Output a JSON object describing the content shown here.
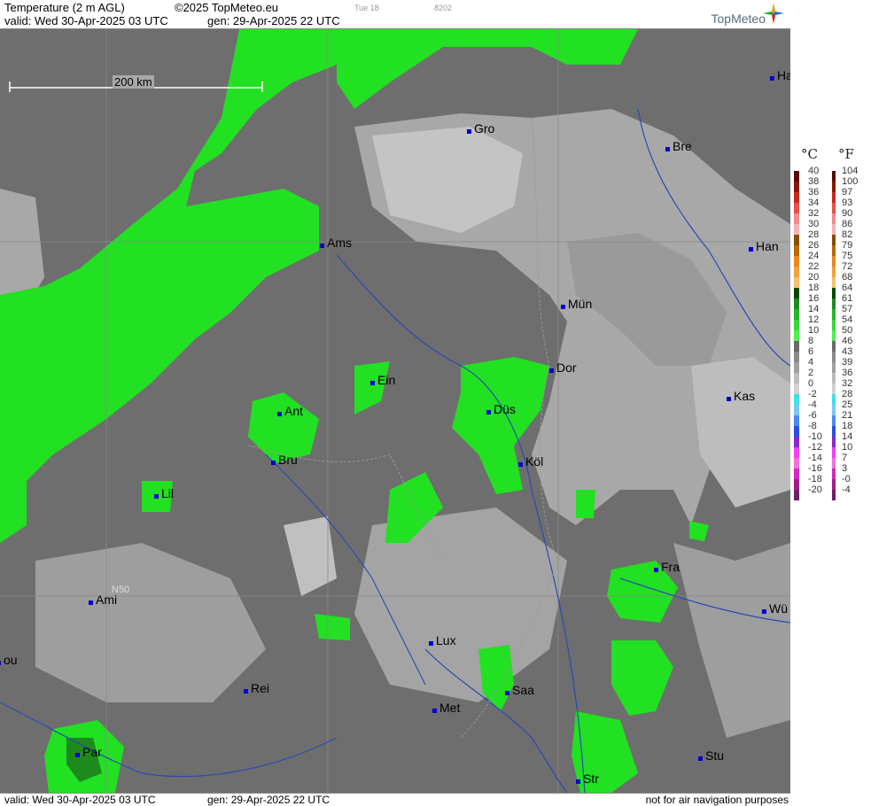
{
  "header": {
    "title": "Temperature (2 m AGL)",
    "copyright": "©2025 TopMeteo.eu",
    "run_small_1": "Tue 18",
    "run_small_2": "8202",
    "valid": "valid:  Wed  30-Apr-2025  03 UTC",
    "gen": "gen:  29-Apr-2025 22 UTC",
    "logo_text": "TopMeteo"
  },
  "footer": {
    "valid": "valid:  Wed  30-Apr-2025  03 UTC",
    "gen": "gen:  29-Apr-2025 22 UTC",
    "disclaimer": "not for air navigation purposes"
  },
  "map": {
    "scale_label": "200 km",
    "lat_label": "N50",
    "cities": [
      "Gro",
      "Bre",
      "Ha",
      "Ams",
      "Han",
      "Mün",
      "Dor",
      "Ein",
      "Kas",
      "Ant",
      "Düs",
      "Bru",
      "Köl",
      "Lil",
      "Fra",
      "Ami",
      "Wü",
      "Lux",
      "ou",
      "Rei",
      "Saa",
      "Met",
      "Par",
      "Stu",
      "Str"
    ]
  },
  "legend": {
    "celsius_unit": "°C",
    "fahrenheit_unit": "°F",
    "celsius": [
      "40",
      "38",
      "36",
      "34",
      "32",
      "30",
      "28",
      "26",
      "24",
      "22",
      "20",
      "18",
      "16",
      "14",
      "12",
      "10",
      "8",
      "6",
      "4",
      "2",
      "0",
      "-2",
      "-4",
      "-6",
      "-8",
      "-10",
      "-12",
      "-14",
      "-16",
      "-18",
      "-20"
    ],
    "fahrenheit": [
      "104",
      "100",
      "97",
      "93",
      "90",
      "86",
      "82",
      "79",
      "75",
      "72",
      "68",
      "64",
      "61",
      "57",
      "54",
      "50",
      "46",
      "43",
      "39",
      "36",
      "32",
      "28",
      "25",
      "21",
      "18",
      "14",
      "10",
      "7",
      "3",
      "-0",
      "-4"
    ],
    "colors": [
      "#5c0a00",
      "#8a1a00",
      "#c8281e",
      "#e8504a",
      "#f08c8c",
      "#f5b4b4",
      "#8a4a00",
      "#b86a00",
      "#e8881e",
      "#f0a040",
      "#f5c070",
      "#004a00",
      "#1e8a1e",
      "#28b428",
      "#3cd43c",
      "#50f050",
      "#6a6a6a",
      "#8a8a8a",
      "#a0a0a0",
      "#bcbcbc",
      "#d2d2d2",
      "#40e0e8",
      "#78c8f0",
      "#4a8cf0",
      "#2850e0",
      "#8a28c8",
      "#f040f0",
      "#f070e0",
      "#d428c0",
      "#a01e8a",
      "#701e64"
    ]
  }
}
